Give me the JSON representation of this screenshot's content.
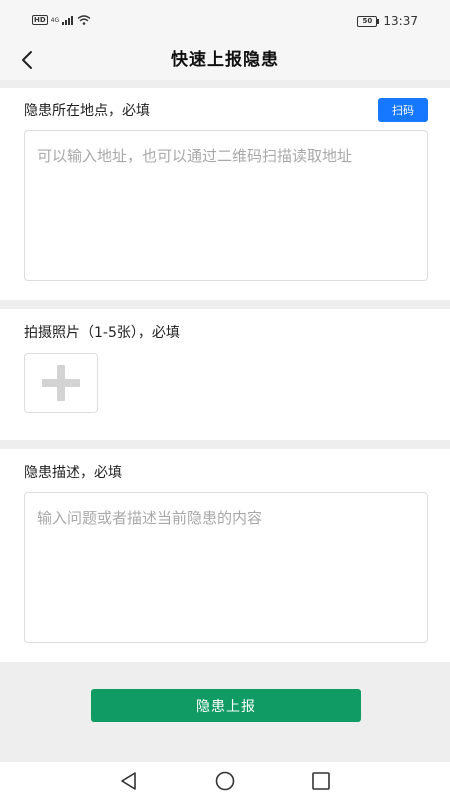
{
  "status_bar": {
    "hd": "HD",
    "network": "4G",
    "battery": "50",
    "time": "13:37"
  },
  "header": {
    "title": "快速上报隐患"
  },
  "location": {
    "label": "隐患所在地点，必填",
    "scan_label": "扫码",
    "placeholder": "可以输入地址，也可以通过二维码扫描读取地址"
  },
  "photos": {
    "label": "拍摄照片（1-5张），必填"
  },
  "description": {
    "label": "隐患描述，必填",
    "placeholder": "输入问题或者描述当前隐患的内容"
  },
  "footer": {
    "submit_label": "隐患上报"
  },
  "icons": {
    "back": "chevron-left-icon",
    "add_photo": "plus-icon",
    "nav_back": "triangle-back-icon",
    "nav_home": "circle-home-icon",
    "nav_recent": "square-recent-icon"
  },
  "colors": {
    "scan_button": "#1677ff",
    "submit_button": "#0f9b63",
    "section_gap": "#eeeeee"
  }
}
